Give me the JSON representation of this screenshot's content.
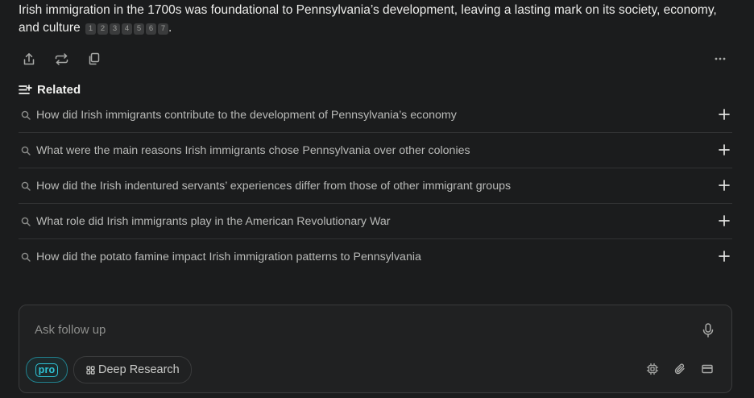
{
  "answer": {
    "text": "Irish immigration in the 1700s was foundational to Pennsylvania’s development, leaving a lasting mark on its society, economy, and culture",
    "citations": [
      "1",
      "2",
      "3",
      "4",
      "5",
      "6",
      "7"
    ],
    "end_punct": "."
  },
  "toolbar": {
    "icons": [
      "share-icon",
      "rewrite-icon",
      "copy-icon",
      "more-icon"
    ]
  },
  "related": {
    "title": "Related",
    "items": [
      {
        "text": "How did Irish immigrants contribute to the development of Pennsylvania’s economy"
      },
      {
        "text": "What were the main reasons Irish immigrants chose Pennsylvania over other colonies"
      },
      {
        "text": "How did the Irish indentured servants’ experiences differ from those of other immigrant groups"
      },
      {
        "text": "What role did Irish immigrants play in the American Revolutionary War"
      },
      {
        "text": "How did the potato famine impact Irish immigration patterns to Pennsylvania"
      }
    ]
  },
  "composer": {
    "placeholder": "Ask follow up",
    "pro_label": "pro",
    "deep_research_label": "Deep Research"
  },
  "colors": {
    "background": "#1b1c1d",
    "accent": "#2ec4d6",
    "muted_text": "#b9bab8"
  }
}
